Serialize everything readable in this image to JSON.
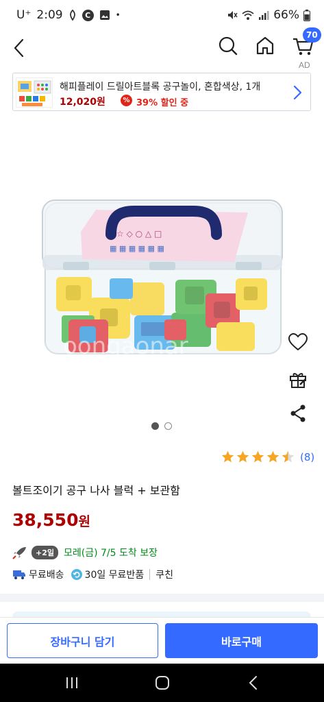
{
  "status_bar": {
    "carrier": "U⁺",
    "time": "2:09",
    "battery": "66%",
    "icons": [
      "clock-icon",
      "c-circle-icon",
      "image-icon",
      "mute-icon",
      "wifi-icon",
      "signal-icon",
      "battery-icon"
    ]
  },
  "nav": {
    "cart_count": "70",
    "icons": [
      "back-icon",
      "search-icon",
      "home-icon",
      "cart-icon"
    ]
  },
  "ad": {
    "label": "AD",
    "title": "해피플레이 드릴아트블록 공구놀이, 혼합색상, 1개",
    "price": "12,020원",
    "discount": "39% 할인 중",
    "discount_icon": "%"
  },
  "product": {
    "watermark": "oongaonar",
    "image_count": 2,
    "active_image": 1,
    "rating": 4.5,
    "review_count": "(8)",
    "title": "볼트조이기 공구 나사 블럭 + 보관함",
    "price": "38,550",
    "price_unit": "원"
  },
  "delivery": {
    "badge": "+2일",
    "text": "모레(금) 7/5 도착 보장"
  },
  "shipping": {
    "free_shipping": "무료배송",
    "free_return": "30일 무료반품",
    "seller": "쿠친"
  },
  "buttons": {
    "add_to_cart": "장바구니 담기",
    "buy_now": "바로구매"
  },
  "colors": {
    "accent": "#346aff",
    "price": "#ae0000",
    "delivery": "#00891a",
    "star": "#f5a623"
  }
}
